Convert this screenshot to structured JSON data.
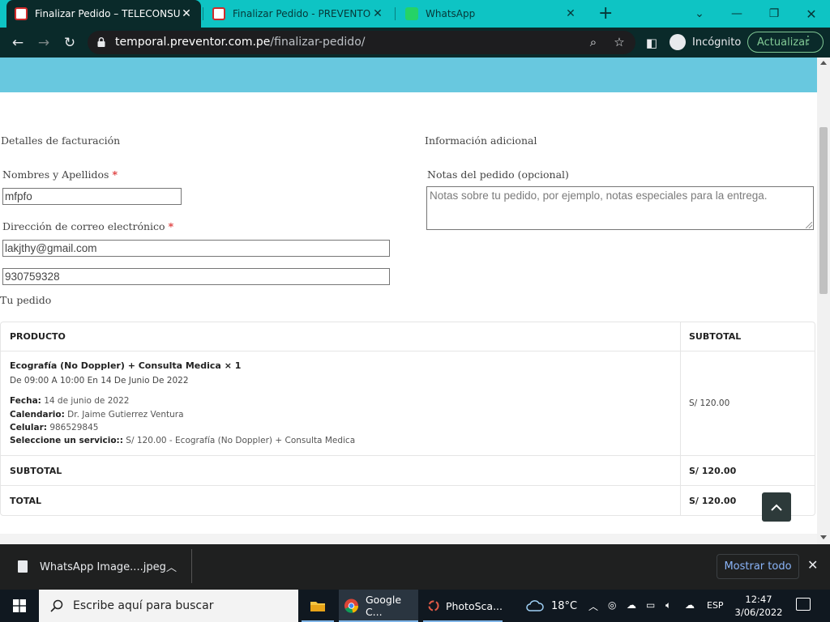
{
  "browser": {
    "tabs": [
      {
        "title": "Finalizar Pedido – TELECONSULTA",
        "active": true
      },
      {
        "title": "Finalizar Pedido - PREVENTOR - ",
        "active": false
      },
      {
        "title": "WhatsApp",
        "active": false
      }
    ],
    "new_tab_symbol": "+",
    "url_domain": "temporal.preventor.com.pe",
    "url_path": "/finalizar-pedido/",
    "incognito_label": "Incógnito",
    "update_label": "Actualizar"
  },
  "page": {
    "billing_heading": "Detalles de facturación",
    "additional_heading": "Información adicional",
    "name_label": "Nombres y Apellidos",
    "name_value": "mfpfo",
    "email_label": "Dirección de correo electrónico",
    "email_value": "lakjthy@gmail.com",
    "phone_value": "930759328",
    "required_mark": "*",
    "notes_label": "Notas del pedido (opcional)",
    "notes_placeholder": "Notas sobre tu pedido, por ejemplo, notas especiales para la entrega.",
    "order_heading": "Tu pedido",
    "table": {
      "col_product": "PRODUCTO",
      "col_subtotal": "SUBTOTAL",
      "item_name": "Ecografía (No Doppler) + Consulta Medica",
      "item_qty": "× 1",
      "item_schedule": "De 09:00 A 10:00 En 14 De Junio De 2022",
      "meta": [
        {
          "key": "Fecha:",
          "value": "14 de junio de 2022"
        },
        {
          "key": "Calendario:",
          "value": "Dr. Jaime Gutierrez Ventura"
        },
        {
          "key": "Celular:",
          "value": "986529845"
        },
        {
          "key": "Seleccione un servicio::",
          "value": "S/ 120.00 - Ecografía (No Doppler) + Consulta Medica"
        }
      ],
      "item_price": "S/ 120.00",
      "subtotal_label": "SUBTOTAL",
      "subtotal_value": "S/ 120.00",
      "total_label": "TOTAL",
      "total_value": "S/ 120.00"
    }
  },
  "downloads": {
    "file_name": "WhatsApp Image....jpeg",
    "show_all": "Mostrar todo"
  },
  "taskbar": {
    "search_placeholder": "Escribe aquí para buscar",
    "apps": [
      {
        "label": "Google C..."
      },
      {
        "label": "PhotoSca..."
      }
    ],
    "temperature": "18°C",
    "language": "ESP",
    "time": "12:47",
    "date": "3/06/2022"
  },
  "colors": {
    "tabstrip": "#0ec4c4",
    "toolbar": "#0a2a2a",
    "hero_band": "#68c8df",
    "required": "#dd3333",
    "update_green": "#81c995"
  }
}
